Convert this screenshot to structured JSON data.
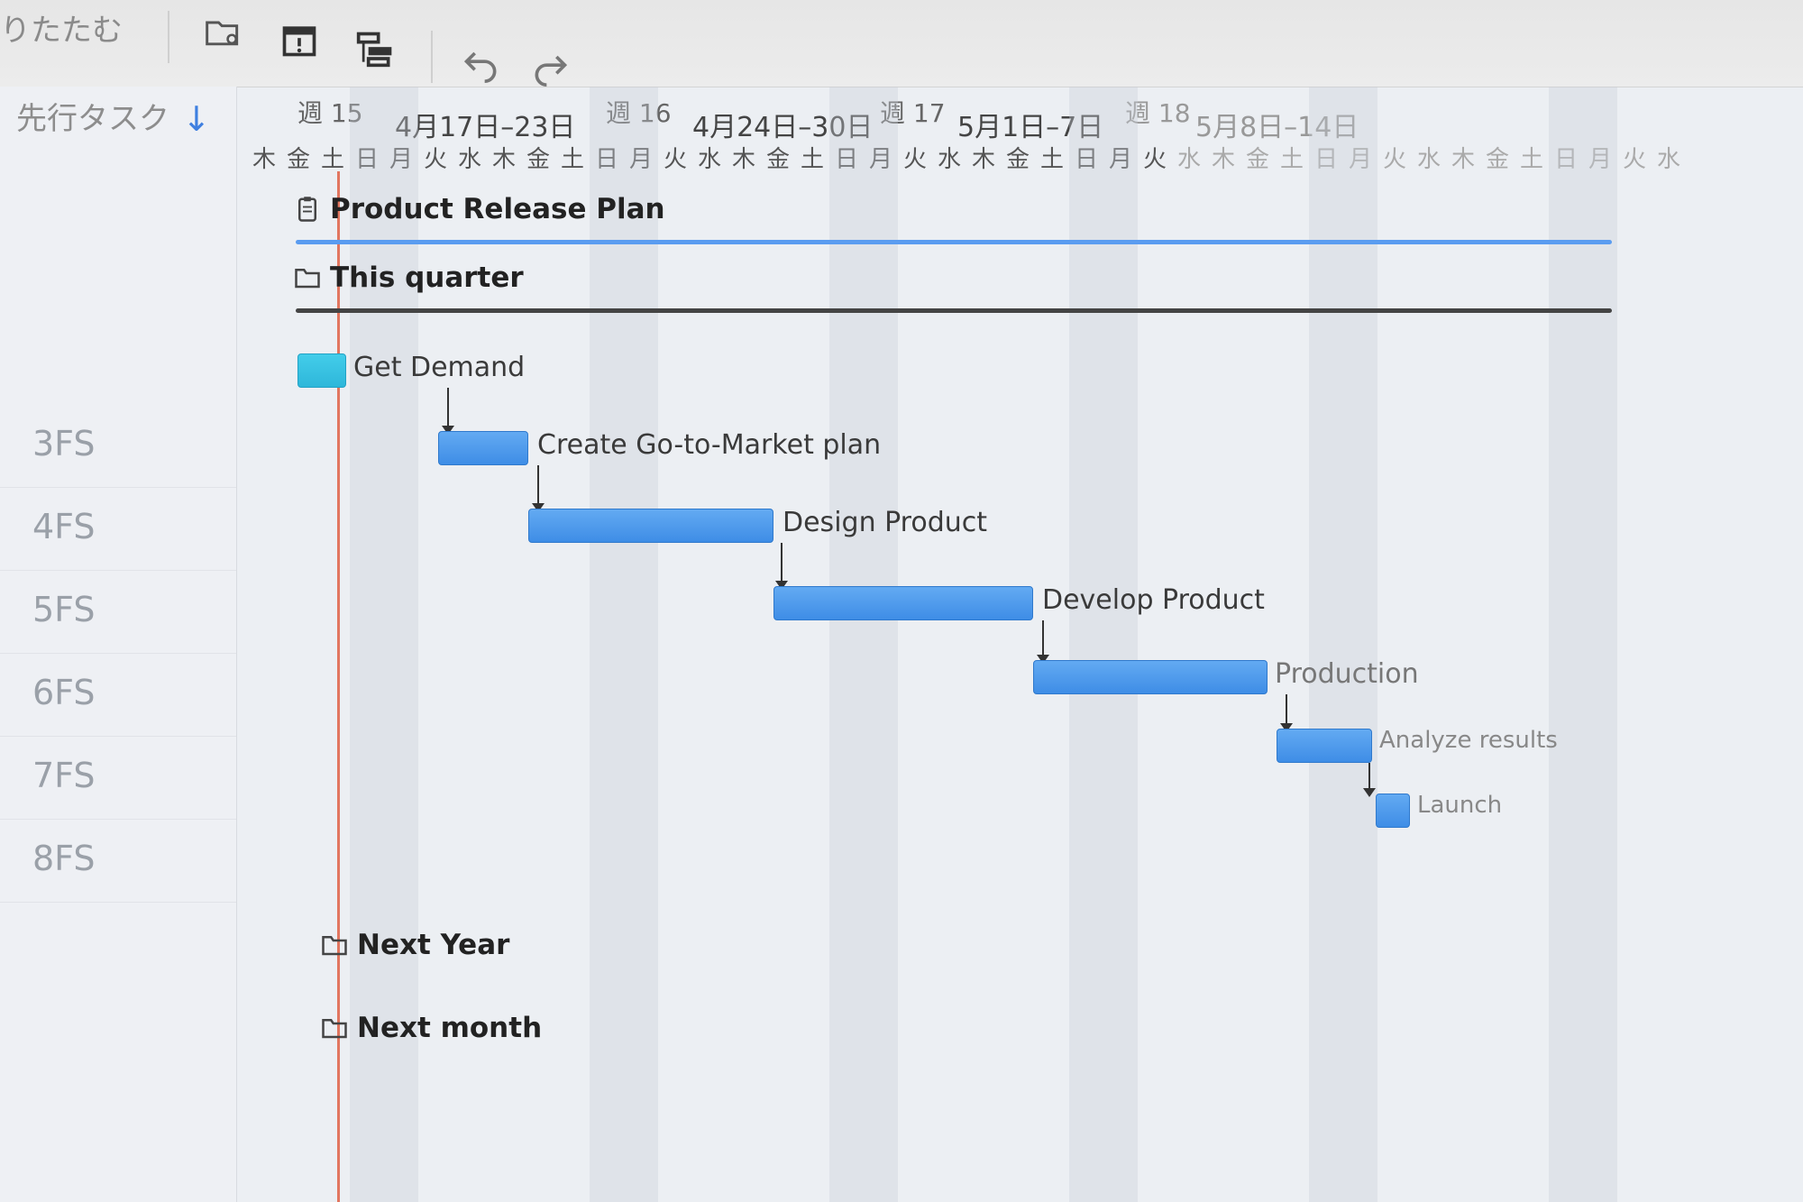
{
  "toolbar": {
    "collapse_label": "りたたむ",
    "icons": [
      "folder-settings-icon",
      "calendar-alert-icon",
      "hierarchy-icon",
      "undo-icon",
      "redo-icon"
    ]
  },
  "left_panel": {
    "header": "先行タスク",
    "predecessors": [
      "3FS",
      "4FS",
      "5FS",
      "6FS",
      "7FS",
      "8FS"
    ]
  },
  "timeline": {
    "weeks": [
      {
        "week": "週 15",
        "range": "4月17日–23日"
      },
      {
        "week": "週 16",
        "range": "4月24日–30日"
      },
      {
        "week": "週 17",
        "range": "5月1日–7日"
      },
      {
        "week": "週 18",
        "range": "5月8日–14日"
      }
    ],
    "days": [
      "木",
      "金",
      "土",
      "日",
      "月",
      "火",
      "水",
      "木",
      "金",
      "土",
      "日",
      "月",
      "火",
      "水",
      "木",
      "金",
      "土",
      "日",
      "月",
      "火",
      "水",
      "木",
      "金",
      "土",
      "日",
      "月",
      "火",
      "水",
      "木",
      "金",
      "土",
      "日",
      "月",
      "火",
      "水",
      "木",
      "金",
      "土",
      "日",
      "月",
      "火",
      "水"
    ]
  },
  "plan": {
    "project": "Product Release Plan",
    "group": "This quarter",
    "tasks": [
      {
        "name": "Get Demand"
      },
      {
        "name": "Create Go-to-Market plan"
      },
      {
        "name": "Design Product"
      },
      {
        "name": "Develop Product"
      },
      {
        "name": "Production"
      },
      {
        "name": "Analyze results"
      },
      {
        "name": "Launch"
      }
    ],
    "other_groups": [
      "Next Year",
      "Next month"
    ]
  },
  "colors": {
    "task_bar": "#4a97ea",
    "first_task_bar": "#35c2e2",
    "project_summary": "#5a9cf0",
    "group_summary": "#444444",
    "today_line": "#e2765f"
  }
}
